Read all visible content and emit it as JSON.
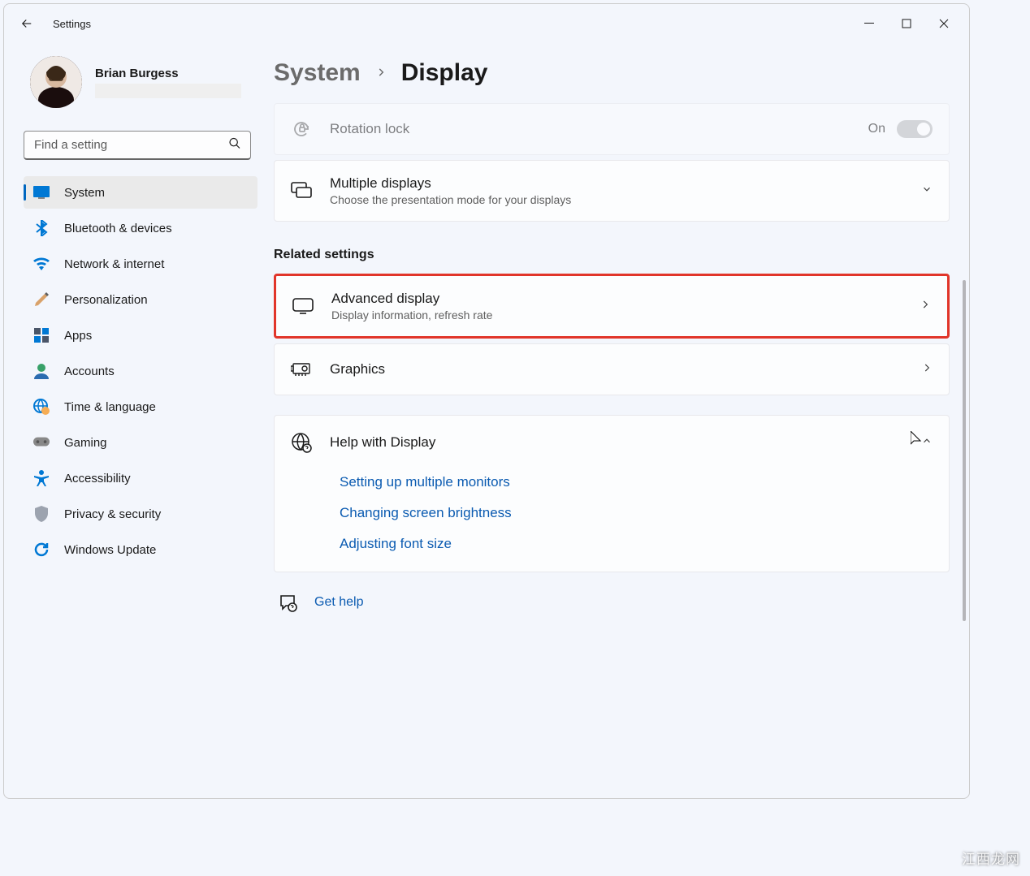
{
  "app": {
    "title": "Settings"
  },
  "profile": {
    "name": "Brian Burgess"
  },
  "search": {
    "placeholder": "Find a setting"
  },
  "sidebar": {
    "items": [
      {
        "label": "System"
      },
      {
        "label": "Bluetooth & devices"
      },
      {
        "label": "Network & internet"
      },
      {
        "label": "Personalization"
      },
      {
        "label": "Apps"
      },
      {
        "label": "Accounts"
      },
      {
        "label": "Time & language"
      },
      {
        "label": "Gaming"
      },
      {
        "label": "Accessibility"
      },
      {
        "label": "Privacy & security"
      },
      {
        "label": "Windows Update"
      }
    ]
  },
  "breadcrumb": {
    "parent": "System",
    "current": "Display"
  },
  "cards": {
    "rotation": {
      "title": "Rotation lock",
      "state": "On"
    },
    "multi": {
      "title": "Multiple displays",
      "sub": "Choose the presentation mode for your displays"
    },
    "advanced": {
      "title": "Advanced display",
      "sub": "Display information, refresh rate"
    },
    "graphics": {
      "title": "Graphics"
    }
  },
  "sections": {
    "related": "Related settings"
  },
  "help": {
    "title": "Help with Display",
    "links": [
      "Setting up multiple monitors",
      "Changing screen brightness",
      "Adjusting font size"
    ]
  },
  "getHelp": {
    "label": "Get help"
  },
  "watermark": "江西龙网"
}
